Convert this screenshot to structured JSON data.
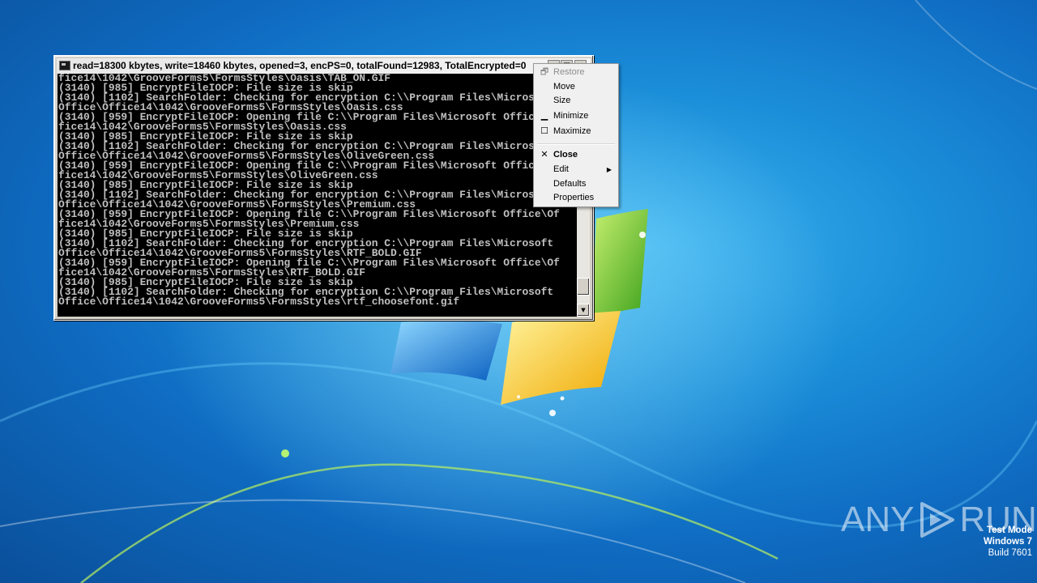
{
  "console": {
    "title": "read=18300 kbytes, write=18460 kbytes, opened=3, encPS=0, totalFound=12983, TotalEncrypted=0",
    "caption_buttons": {
      "minimize": "_",
      "maximize": "□",
      "close": "×"
    },
    "lines": [
      "fice14\\1042\\GrooveForms5\\FormsStyles\\Oasis\\TAB_ON.GIF",
      "(3140) [985] EncryptFileIOCP: File size is skip",
      "(3140) [1102] SearchFolder: Checking for encryption C:\\\\Program Files\\Microsoft",
      "Office\\Office14\\1042\\GrooveForms5\\FormsStyles\\Oasis.css",
      "(3140) [959] EncryptFileIOCP: Opening file C:\\\\Program Files\\Microsoft Office\\Of",
      "fice14\\1042\\GrooveForms5\\FormsStyles\\Oasis.css",
      "(3140) [985] EncryptFileIOCP: File size is skip",
      "(3140) [1102] SearchFolder: Checking for encryption C:\\\\Program Files\\Microsoft",
      "Office\\Office14\\1042\\GrooveForms5\\FormsStyles\\OliveGreen.css",
      "(3140) [959] EncryptFileIOCP: Opening file C:\\\\Program Files\\Microsoft Office\\Of",
      "fice14\\1042\\GrooveForms5\\FormsStyles\\OliveGreen.css",
      "(3140) [985] EncryptFileIOCP: File size is skip",
      "(3140) [1102] SearchFolder: Checking for encryption C:\\\\Program Files\\Microsoft",
      "Office\\Office14\\1042\\GrooveForms5\\FormsStyles\\Premium.css",
      "(3140) [959] EncryptFileIOCP: Opening file C:\\\\Program Files\\Microsoft Office\\Of",
      "fice14\\1042\\GrooveForms5\\FormsStyles\\Premium.css",
      "(3140) [985] EncryptFileIOCP: File size is skip",
      "(3140) [1102] SearchFolder: Checking for encryption C:\\\\Program Files\\Microsoft",
      "Office\\Office14\\1042\\GrooveForms5\\FormsStyles\\RTF_BOLD.GIF",
      "(3140) [959] EncryptFileIOCP: Opening file C:\\\\Program Files\\Microsoft Office\\Of",
      "fice14\\1042\\GrooveForms5\\FormsStyles\\RTF_BOLD.GIF",
      "(3140) [985] EncryptFileIOCP: File size is skip",
      "(3140) [1102] SearchFolder: Checking for encryption C:\\\\Program Files\\Microsoft",
      "Office\\Office14\\1042\\GrooveForms5\\FormsStyles\\rtf_choosefont.gif"
    ],
    "scrollbar": {
      "position_fraction": 0.96
    }
  },
  "system_menu": {
    "items": [
      {
        "label": "Restore",
        "icon": "restore-icon",
        "glyph": "🗗",
        "disabled": true
      },
      {
        "label": "Move",
        "icon": "",
        "glyph": "",
        "disabled": false
      },
      {
        "label": "Size",
        "icon": "",
        "glyph": "",
        "disabled": false
      },
      {
        "label": "Minimize",
        "icon": "minimize-icon",
        "glyph": "▁",
        "disabled": false
      },
      {
        "label": "Maximize",
        "icon": "maximize-icon",
        "glyph": "☐",
        "disabled": false
      },
      {
        "label": "Close",
        "icon": "close-icon",
        "glyph": "✕",
        "disabled": false,
        "bold": true
      },
      {
        "label": "Edit",
        "icon": "",
        "glyph": "",
        "disabled": false,
        "submenu": true
      },
      {
        "label": "Defaults",
        "icon": "",
        "glyph": "",
        "disabled": false
      },
      {
        "label": "Properties",
        "icon": "",
        "glyph": "",
        "disabled": false
      }
    ]
  },
  "watermark": {
    "left_text": "ANY",
    "right_text": "RUN",
    "icon": "play-icon"
  },
  "os_info": {
    "mode": "Test Mode",
    "os": "Windows 7",
    "build": "Build 7601"
  },
  "colors": {
    "terminal_background": "#000000",
    "terminal_text": "#c0c0c0",
    "desktop_blue": "#1b8ed9",
    "menu_background": "#f0f0f0"
  }
}
